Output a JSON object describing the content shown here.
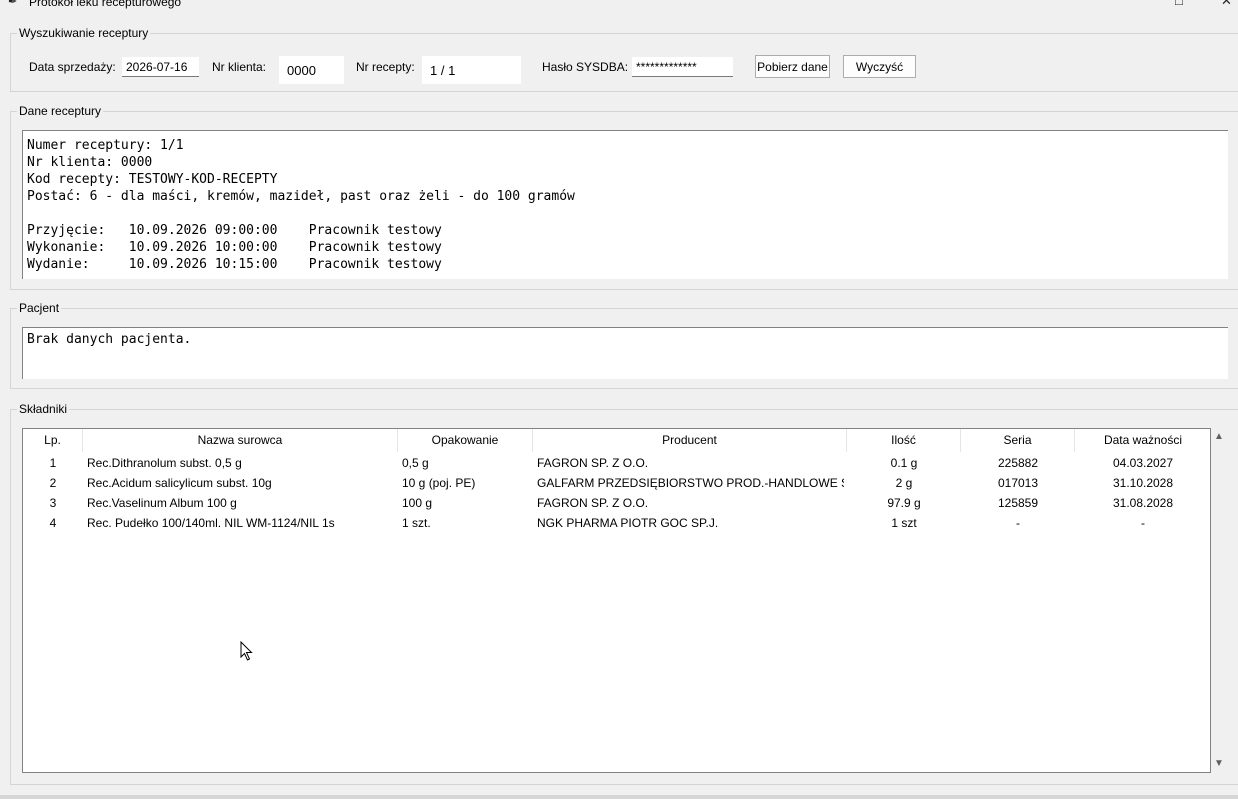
{
  "window": {
    "title": "Protokół leku recepturowego",
    "maximize_glyph": "□",
    "close_glyph": "✕"
  },
  "search": {
    "group_label": "Wyszukiwanie receptury",
    "date_label": "Data sprzedaży:",
    "date_value": "2026-07-16",
    "client_label": "Nr klienta:",
    "client_value": "0000",
    "recipe_label": "Nr recepty:",
    "recipe_value": "1 / 1",
    "password_label": "Hasło SYSDBA:",
    "password_value": "*************",
    "fetch_button": "Pobierz dane",
    "clear_button": "Wyczyść"
  },
  "recipe": {
    "group_label": "Dane receptury",
    "text": "Numer receptury: 1/1\nNr klienta: 0000\nKod recepty: TESTOWY-KOD-RECEPTY\nPostać: 6 - dla maści, kremów, mazideł, past oraz żeli - do 100 gramów\n\nPrzyjęcie:   10.09.2026 09:00:00    Pracownik testowy\nWykonanie:   10.09.2026 10:00:00    Pracownik testowy\nWydanie:     10.09.2026 10:15:00    Pracownik testowy"
  },
  "patient": {
    "group_label": "Pacjent",
    "text": "Brak danych pacjenta."
  },
  "ingredients": {
    "group_label": "Składniki",
    "columns": [
      "Lp.",
      "Nazwa surowca",
      "Opakowanie",
      "Producent",
      "Ilość",
      "Seria",
      "Data ważności"
    ],
    "rows": [
      [
        "1",
        "Rec.Dithranolum subst. 0,5 g",
        "0,5 g",
        "FAGRON SP. Z O.O.",
        "0.1 g",
        "225882",
        "04.03.2027"
      ],
      [
        "2",
        "Rec.Acidum salicylicum  subst. 10g",
        "10 g (poj. PE)",
        "GALFARM PRZEDSIĘBIORSTWO PROD.-HANDLOWE SP.Z O.O.",
        "2 g",
        "017013",
        "31.10.2028"
      ],
      [
        "3",
        "Rec.Vaselinum Album 100 g",
        "100 g",
        "FAGRON SP. Z O.O.",
        "97.9 g",
        "125859",
        "31.08.2028"
      ],
      [
        "4",
        "Rec. Pudełko 100/140ml. NIL WM-1124/NIL 1s",
        "1 szt.",
        "NGK PHARMA PIOTR GOC SP.J.",
        "1 szt",
        "-",
        "-"
      ]
    ]
  }
}
